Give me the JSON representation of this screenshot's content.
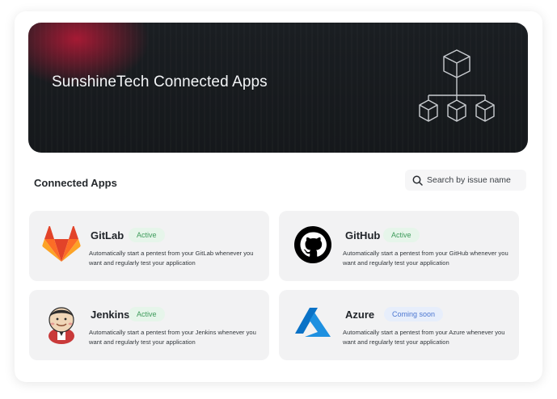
{
  "banner": {
    "title": "SunshineTech Connected Apps",
    "icon": "hierarchy-cubes-icon"
  },
  "section": {
    "title": "Connected Apps"
  },
  "search": {
    "placeholder": "Search by issue name",
    "icon": "search-icon"
  },
  "apps": [
    {
      "name": "GitLab",
      "status": "Active",
      "status_type": "active",
      "description": "Automatically start a pentest from your GitLab whenever you want and regularly test your application",
      "icon": "gitlab-icon"
    },
    {
      "name": "GitHub",
      "status": "Active",
      "status_type": "active",
      "description": "Automatically start a pentest from your GitHub whenever you want and regularly test your application",
      "icon": "github-icon"
    },
    {
      "name": "Jenkins",
      "status": "Active",
      "status_type": "active",
      "description": "Automatically start a pentest from your Jenkins whenever you want and regularly test your application",
      "icon": "jenkins-icon"
    },
    {
      "name": "Azure",
      "status": "Coming soon",
      "status_type": "soon",
      "description": "Automatically start a pentest from your Azure whenever you want and regularly test your application",
      "icon": "azure-icon"
    }
  ],
  "colors": {
    "banner_bg": "#15181b",
    "active_badge": "#e6f5ea",
    "active_text": "#3e9b5b",
    "soon_badge": "#e7eefb",
    "soon_text": "#4c77d1",
    "card_bg": "#f2f2f3"
  }
}
